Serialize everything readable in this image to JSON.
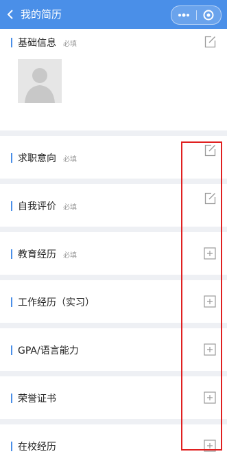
{
  "header": {
    "title": "我的简历",
    "back_icon": "chevron-left-icon",
    "menu_icon": "more-dots-icon",
    "close_icon": "target-circle-icon"
  },
  "sections": [
    {
      "label": "基础信息",
      "required": "必填",
      "action": "edit-icon"
    },
    {
      "label": "求职意向",
      "required": "必填",
      "action": "edit-icon"
    },
    {
      "label": "自我评价",
      "required": "必填",
      "action": "edit-icon"
    },
    {
      "label": "教育经历",
      "required": "必填",
      "action": "add-icon"
    },
    {
      "label": "工作经历（实习）",
      "required": "",
      "action": "add-icon"
    },
    {
      "label": "GPA/语言能力",
      "required": "",
      "action": "add-icon"
    },
    {
      "label": "荣誉证书",
      "required": "",
      "action": "add-icon"
    },
    {
      "label": "在校经历",
      "required": "",
      "action": "add-icon"
    }
  ],
  "colors": {
    "header_bg": "#4a8fe8",
    "accent": "#4a8fe8",
    "highlight_border": "#e02020",
    "page_bg": "#eef0f4"
  }
}
